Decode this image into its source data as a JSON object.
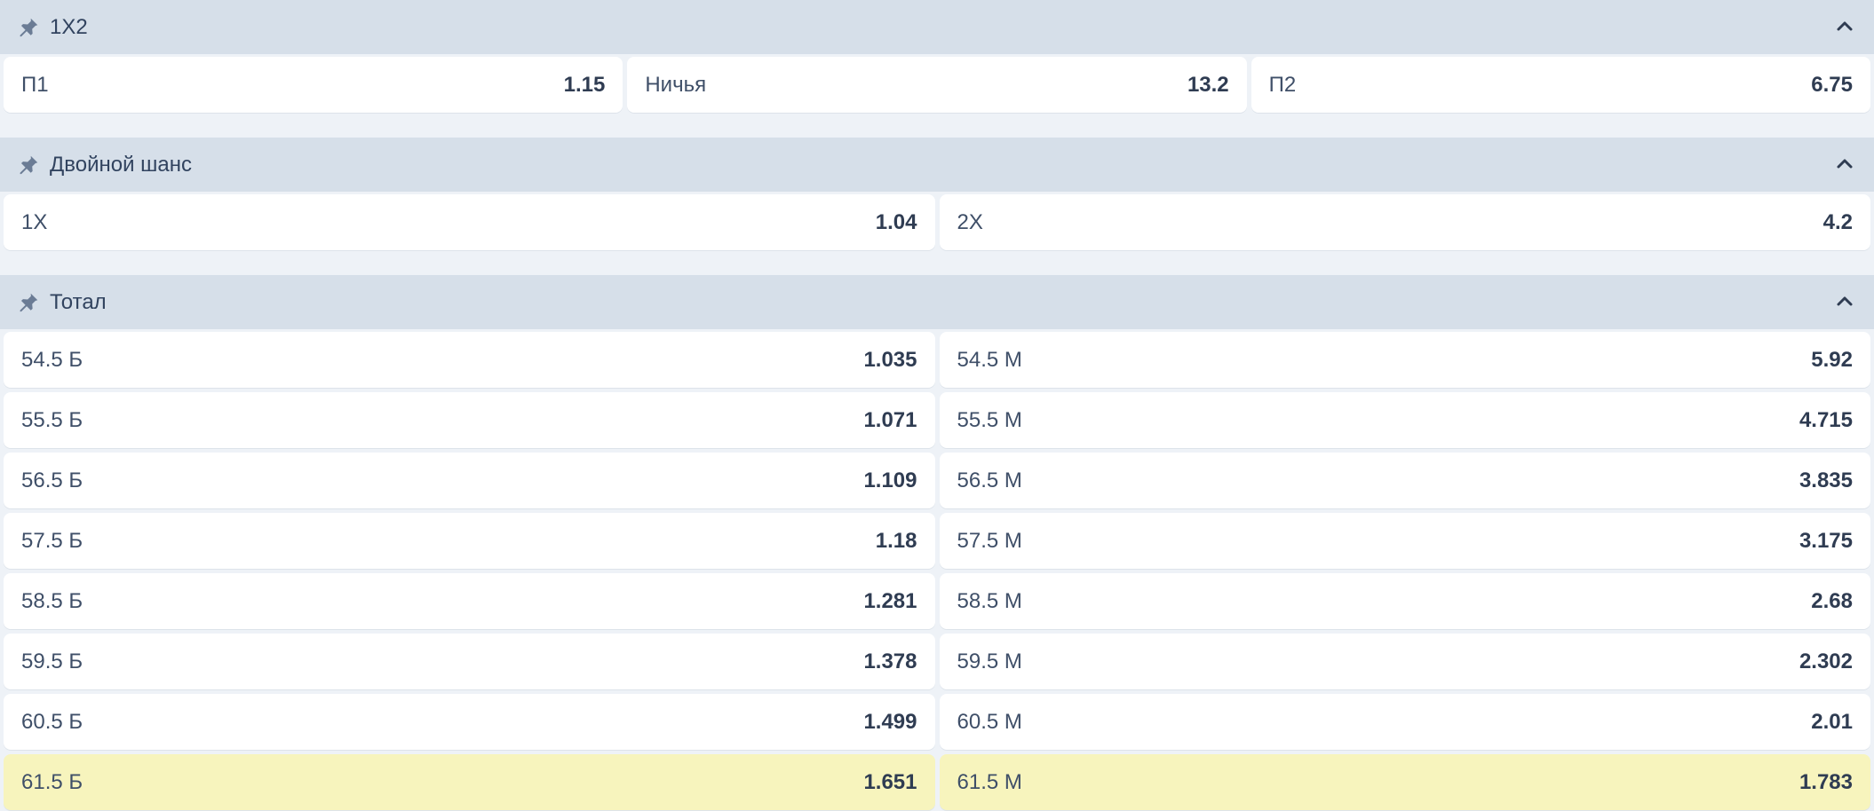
{
  "markets": [
    {
      "title": "1X2",
      "outcomes": [
        {
          "label": "П1",
          "odds": "1.15"
        },
        {
          "label": "Ничья",
          "odds": "13.2"
        },
        {
          "label": "П2",
          "odds": "6.75"
        }
      ]
    },
    {
      "title": "Двойной шанс",
      "outcomes": [
        {
          "label": "1X",
          "odds": "1.04"
        },
        {
          "label": "2X",
          "odds": "4.2"
        }
      ]
    },
    {
      "title": "Тотал",
      "rows": [
        {
          "over_label": "54.5 Б",
          "over_odds": "1.035",
          "under_label": "54.5 М",
          "under_odds": "5.92"
        },
        {
          "over_label": "55.5 Б",
          "over_odds": "1.071",
          "under_label": "55.5 М",
          "under_odds": "4.715"
        },
        {
          "over_label": "56.5 Б",
          "over_odds": "1.109",
          "under_label": "56.5 М",
          "under_odds": "3.835"
        },
        {
          "over_label": "57.5 Б",
          "over_odds": "1.18",
          "under_label": "57.5 М",
          "under_odds": "3.175"
        },
        {
          "over_label": "58.5 Б",
          "over_odds": "1.281",
          "under_label": "58.5 М",
          "under_odds": "2.68"
        },
        {
          "over_label": "59.5 Б",
          "over_odds": "1.378",
          "under_label": "59.5 М",
          "under_odds": "2.302"
        },
        {
          "over_label": "60.5 Б",
          "over_odds": "1.499",
          "under_label": "60.5 М",
          "under_odds": "2.01"
        },
        {
          "over_label": "61.5 Б",
          "over_odds": "1.651",
          "under_label": "61.5 М",
          "under_odds": "1.783"
        }
      ]
    }
  ],
  "icons": {
    "pin": "pin-icon",
    "collapse": "chevron-up-icon"
  },
  "colors": {
    "header_bg": "#d6dfe9",
    "page_bg": "#eef2f7",
    "highlight_bg": "#f7f4bd",
    "text": "#31435f"
  }
}
